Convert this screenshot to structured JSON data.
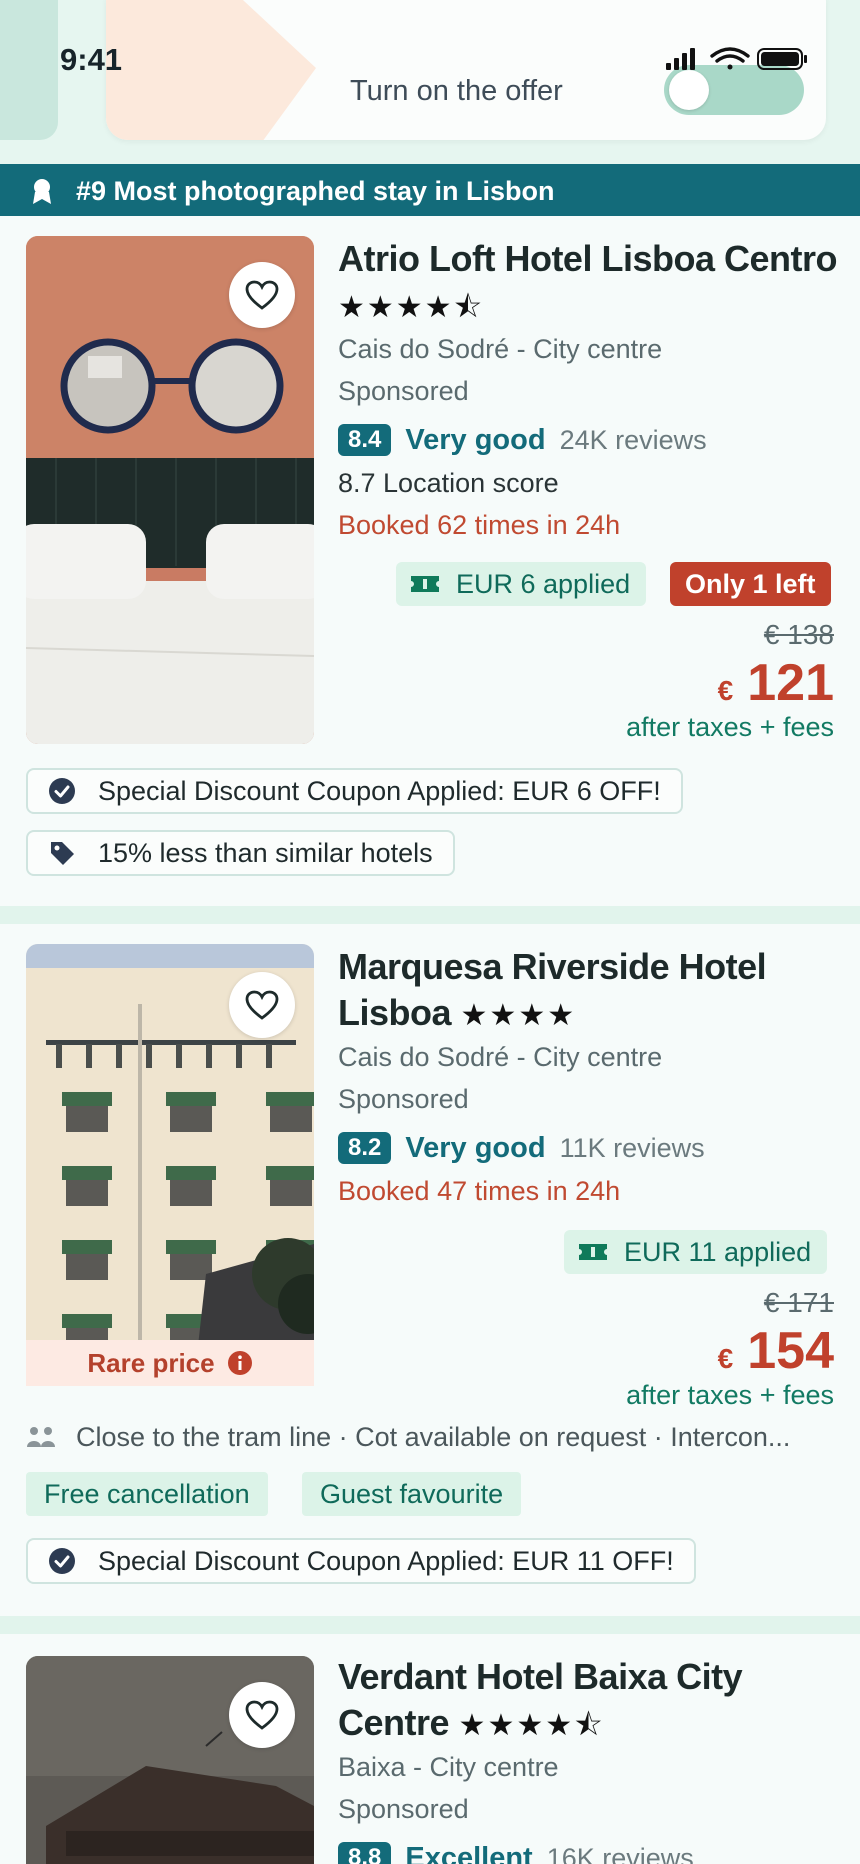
{
  "status_bar": {
    "time": "9:41"
  },
  "offer": {
    "label": "Turn on the offer",
    "enabled": false
  },
  "ribbon": {
    "text": "#9 Most photographed stay in Lisbon"
  },
  "hotels": [
    {
      "name": "Atrio Loft Hotel Lisboa Centro",
      "stars": "★★★★⯪",
      "location": "Cais do Sodré - City centre",
      "sponsored": "Sponsored",
      "score": "8.4",
      "rating_word": "Very good",
      "reviews": "24K reviews",
      "location_score": "8.7 Location score",
      "booked": "Booked 62 times in 24h",
      "applied": "EUR 6 applied",
      "availability": "Only 1 left",
      "old_price": "€ 138",
      "currency": "€",
      "price": "121",
      "after_taxes": "after taxes + fees",
      "coupon": "Special Discount Coupon Applied: EUR 6 OFF!",
      "compare": "15% less than similar hotels"
    },
    {
      "name": "Marquesa Riverside Hotel Lisboa",
      "stars": "★★★★",
      "location": "Cais do Sodré - City centre",
      "sponsored": "Sponsored",
      "score": "8.2",
      "rating_word": "Very good",
      "reviews": "11K reviews",
      "booked": "Booked 47 times in 24h",
      "applied": "EUR 11 applied",
      "old_price": "€ 171",
      "currency": "€",
      "price": "154",
      "after_taxes": "after taxes + fees",
      "rare_price": "Rare price",
      "amenities": "Close to the tram line · Cot available on request · Intercon...",
      "tags": [
        "Free cancellation",
        "Guest favourite"
      ],
      "coupon": "Special Discount Coupon Applied: EUR 11 OFF!"
    },
    {
      "name": "Verdant Hotel Baixa City Centre",
      "stars": "★★★★⯪",
      "location": "Baixa - City centre",
      "sponsored": "Sponsored",
      "score": "8.8",
      "rating_word": "Excellent",
      "reviews": "16K reviews"
    }
  ]
}
